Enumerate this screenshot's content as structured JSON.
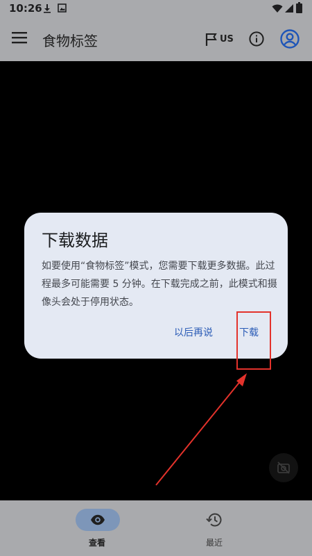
{
  "status_bar": {
    "time": "10:26",
    "left_icons": [
      "download-icon",
      "image-icon"
    ],
    "right_icons": [
      "wifi-icon",
      "signal-icon",
      "battery-icon"
    ]
  },
  "app_bar": {
    "title": "食物标签",
    "region": "US",
    "icons": [
      "menu-icon",
      "flag-icon",
      "info-icon",
      "account-icon"
    ]
  },
  "dialog": {
    "title": "下载数据",
    "body": "如要使用“食物标签”模式，您需要下载更多数据。此过程最多可能需要 5 分钟。在下载完成之前，此模式和摄像头会处于停用状态。",
    "buttons": {
      "later": "以后再说",
      "download": "下载"
    }
  },
  "bottom_nav": {
    "items": [
      {
        "label": "查看",
        "icon": "eye-icon",
        "selected": true
      },
      {
        "label": "最近",
        "icon": "history-icon",
        "selected": false
      }
    ]
  },
  "colors": {
    "bar_background": "#a9aaad",
    "dialog_background": "#e4e9f3",
    "accent": "#2a5bb6",
    "annotation": "#e3322b",
    "nav_pill": "#7d96b9"
  }
}
